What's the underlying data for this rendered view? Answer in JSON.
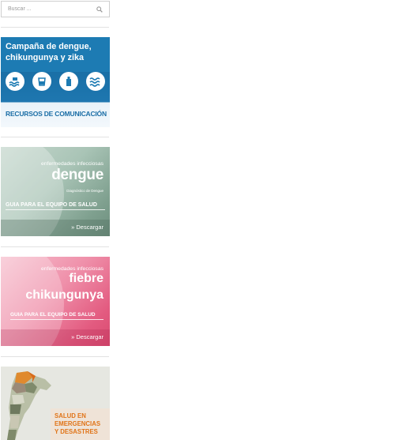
{
  "search": {
    "placeholder": "Buscar ..."
  },
  "banners": {
    "campana": {
      "title": "Campaña de dengue, chikungunya y zika",
      "footer": "RECURSOS DE COMUNICACIÓN",
      "icons": [
        "wave-icon",
        "bucket-icon",
        "bottle-icon",
        "water-icon"
      ],
      "color": "#1d7bb3"
    },
    "dengue": {
      "category": "enfermedades infecciosas",
      "name": "dengue",
      "subtitle": "Diagnóstico de Dengue",
      "guide": "GUIA PARA EL EQUIPO DE SALUD",
      "download": "» Descargar"
    },
    "chikungunya": {
      "category": "enfermedades infecciosas",
      "name_line1": "fiebre",
      "name_line2": "chikungunya",
      "guide": "GUIA PARA EL EQUIPO DE SALUD",
      "download": "» Descargar"
    },
    "emergencias": {
      "line1": "SALUD EN",
      "line2": "EMERGENCIAS",
      "line3": "Y DESASTRES",
      "color": "#e07418"
    }
  }
}
